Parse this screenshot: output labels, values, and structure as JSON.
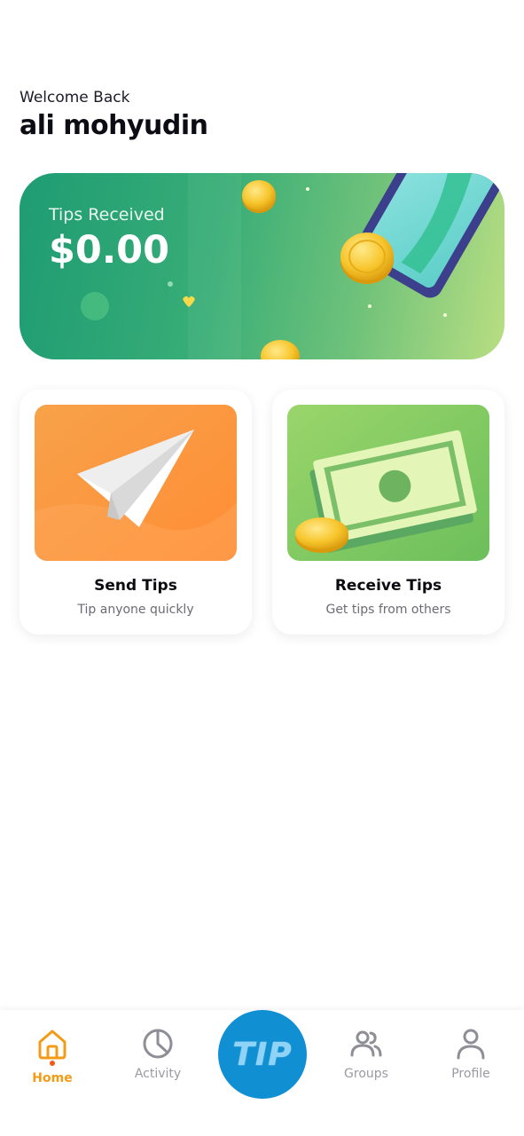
{
  "header": {
    "greeting": "Welcome Back",
    "username": "ali mohyudin"
  },
  "balance": {
    "label": "Tips Received",
    "amount": "$0.00"
  },
  "actions": [
    {
      "title": "Send Tips",
      "subtitle": "Tip anyone quickly"
    },
    {
      "title": "Receive Tips",
      "subtitle": "Get tips from others"
    }
  ],
  "nav": {
    "items": [
      {
        "label": "Home",
        "icon": "home-icon",
        "active": true
      },
      {
        "label": "Activity",
        "icon": "pie-chart-icon",
        "active": false
      },
      {
        "label": "Groups",
        "icon": "users-icon",
        "active": false
      },
      {
        "label": "Profile",
        "icon": "user-icon",
        "active": false
      }
    ],
    "center_button": "TIP"
  },
  "colors": {
    "accent_active": "#f39b17",
    "tip_button": "#118fd3",
    "balance_green": "#38ad77"
  }
}
